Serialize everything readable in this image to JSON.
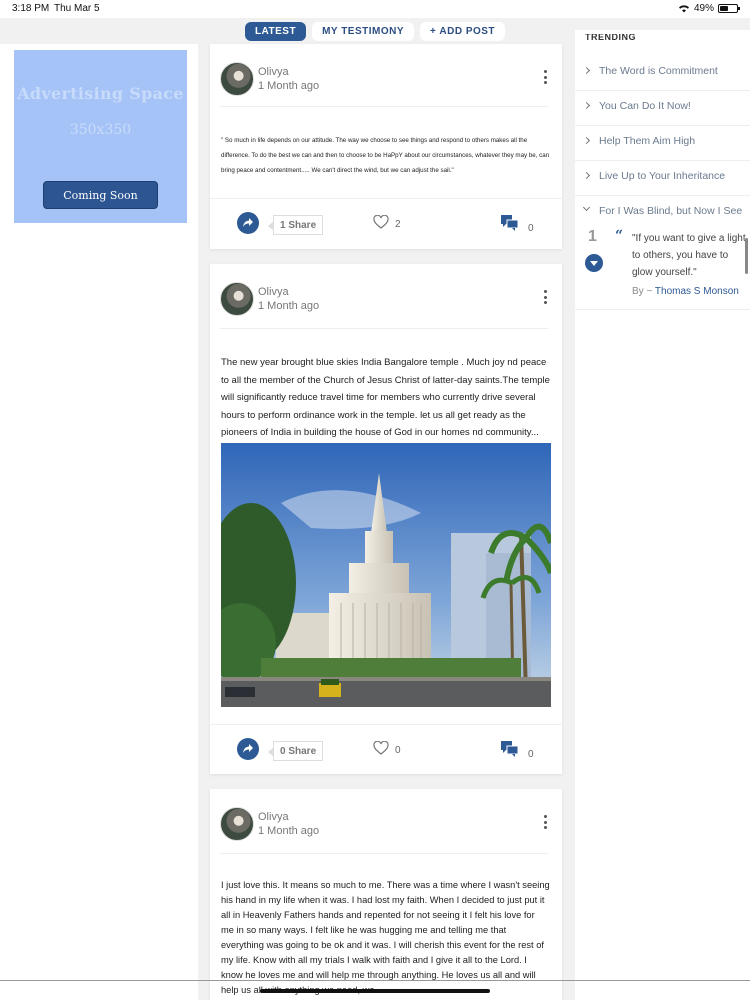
{
  "status_bar": {
    "time": "3:18 PM",
    "date": "Thu Mar 5",
    "battery": "49%"
  },
  "tabs": [
    {
      "label": "LATEST",
      "active": true
    },
    {
      "label": "MY TESTIMONY",
      "active": false
    },
    {
      "label": "ADD POST",
      "prefix": "+",
      "active": false
    }
  ],
  "ad": {
    "title": "Advertising Space",
    "size": "350x350",
    "button": "Coming Soon"
  },
  "posts": [
    {
      "author": "Olivya",
      "time": "1 Month ago",
      "text": "\" So much in life depends on our attitude. The way we choose to see things and respond to others makes all the difference. To do the best we can and then to choose to be HaPpY about our circumstances, whatever they may be, can bring peace and contentment..... We can't direct the wind, but we can adjust the sail.\"",
      "share": "1 Share",
      "likes": "2",
      "comments": "0"
    },
    {
      "author": "Olivya",
      "time": "1 Month ago",
      "text": "The new year brought blue skies India Bangalore temple . Much joy nd peace to all the member of the Church of Jesus Christ of latter-day saints.The temple will significantly reduce travel time for members who currently drive several hours to perform ordinance work in the temple. let us all get ready as the pioneers of India in building the house of God in our homes nd community...",
      "share": "0 Share",
      "likes": "0",
      "comments": "0"
    },
    {
      "author": "Olivya",
      "time": "1 Month ago",
      "text": " I just love this. It means so much to me. There was a time where I wasn't seeing his hand in my life when it was. I had lost my faith. When I decided to just put it all in Heavenly Fathers hands and repented for not seeing it I felt his love for me in so many ways. I felt like he was hugging me and telling me that everything was going to be ok and it was. I will cherish this event for the rest of my life. Know with all my trials I walk with faith and I give it all to the Lord. I know he loves me and will help me through anything. He loves us all and will help us all with anything we need, we"
    }
  ],
  "trending": {
    "title": "TRENDING",
    "items": [
      "The Word is Commitment",
      "You Can Do It Now!",
      "Help Them Aim High",
      "Live Up to Your Inheritance",
      "For I Was Blind, but Now I See"
    ],
    "quote": {
      "number": "1",
      "text": "\"If you want to give a light to others, you have to glow yourself.\"",
      "by": "By ~",
      "author": "Thomas S Monson"
    }
  },
  "colors": {
    "accent": "#2d5a94",
    "ad_bg": "#a5c3f6",
    "page_bg": "#f1f1f1"
  },
  "icons": [
    "wifi-icon",
    "battery-icon",
    "kebab-icon",
    "share-icon",
    "heart-icon",
    "comment-icon",
    "chevron-right-icon",
    "chevron-down-icon",
    "quote-down-icon"
  ]
}
